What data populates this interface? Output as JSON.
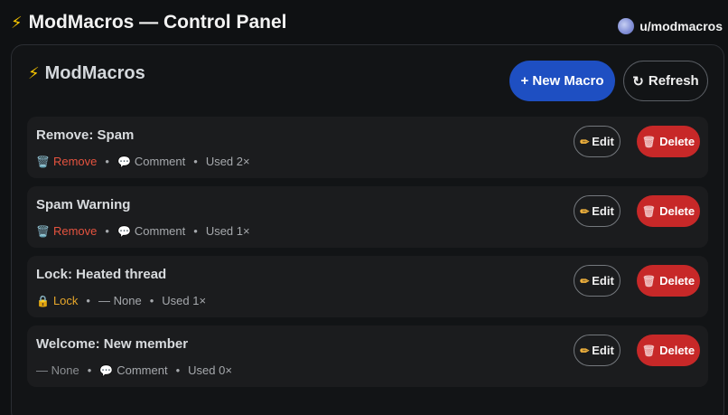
{
  "header": {
    "title": "ModMacros — Control Panel",
    "title_icon": "lightning-bolt-icon",
    "username": "u/modmacros"
  },
  "panel": {
    "title": "ModMacros",
    "new_button": "+ New Macro",
    "refresh_button": "Refresh"
  },
  "colors": {
    "accent": "#1e4fc2",
    "danger": "#c72828",
    "remove": "#e5533f",
    "lock": "#e7a72b"
  },
  "macros": [
    {
      "name": "Remove: Spam",
      "action": "Remove",
      "action_icon": "🗑️",
      "action_type": "remove",
      "reply": "Comment",
      "reply_icon": "💬",
      "used": "Used 2×",
      "edit_label": "Edit",
      "delete_label": "Delete"
    },
    {
      "name": "Spam Warning",
      "action": "Remove",
      "action_icon": "🗑️",
      "action_type": "remove",
      "reply": "Comment",
      "reply_icon": "💬",
      "used": "Used 1×",
      "edit_label": "Edit",
      "delete_label": "Delete"
    },
    {
      "name": "Lock: Heated thread",
      "action": "Lock",
      "action_icon": "🔒",
      "action_type": "lock",
      "reply": "— None",
      "reply_icon": "",
      "used": "Used 1×",
      "edit_label": "Edit",
      "delete_label": "Delete"
    },
    {
      "name": "Welcome: New member",
      "action": "— None",
      "action_icon": "",
      "action_type": "none",
      "reply": "Comment",
      "reply_icon": "💬",
      "used": "Used 0×",
      "edit_label": "Edit",
      "delete_label": "Delete"
    }
  ]
}
